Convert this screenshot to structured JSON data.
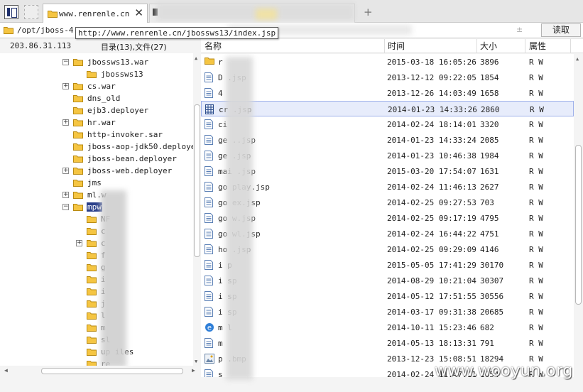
{
  "tab": {
    "title": "www.renrenle.cn"
  },
  "address": {
    "path": "/opt/jboss-4.",
    "sort_icon": "±",
    "read_button": "读取",
    "tooltip": "http://www.renrenle.cn/jbossws13/index.jsp"
  },
  "left": {
    "ip": "203.86.31.113",
    "counts": "目录(13),文件(27)"
  },
  "tree": [
    {
      "label": "jbossws13.war",
      "depth": 0,
      "expander": "−"
    },
    {
      "label": "jbossws13",
      "depth": 1,
      "expander": ""
    },
    {
      "label": "cs.war",
      "depth": 0,
      "expander": "+"
    },
    {
      "label": "dns_old",
      "depth": 0,
      "expander": ""
    },
    {
      "label": "ejb3.deployer",
      "depth": 0,
      "expander": ""
    },
    {
      "label": "hr.war",
      "depth": 0,
      "expander": "+"
    },
    {
      "label": "http-invoker.sar",
      "depth": 0,
      "expander": ""
    },
    {
      "label": "jboss-aop-jdk50.deployer",
      "depth": 0,
      "expander": ""
    },
    {
      "label": "jboss-bean.deployer",
      "depth": 0,
      "expander": ""
    },
    {
      "label": "jboss-web.deployer",
      "depth": 0,
      "expander": "+"
    },
    {
      "label": "jms",
      "depth": 0,
      "expander": ""
    },
    {
      "label": "ml.w",
      "depth": 0,
      "expander": "+"
    },
    {
      "label": "mpw",
      "depth": 0,
      "expander": "−",
      "selected": true
    },
    {
      "label": "NF",
      "depth": 1,
      "expander": ""
    },
    {
      "label": "c",
      "depth": 1,
      "expander": ""
    },
    {
      "label": "c",
      "depth": 1,
      "expander": "+"
    },
    {
      "label": "f",
      "depth": 1,
      "expander": ""
    },
    {
      "label": "g",
      "depth": 1,
      "expander": ""
    },
    {
      "label": "i",
      "depth": 1,
      "expander": ""
    },
    {
      "label": "i",
      "depth": 1,
      "expander": ""
    },
    {
      "label": "j",
      "depth": 1,
      "expander": ""
    },
    {
      "label": "l",
      "depth": 1,
      "expander": ""
    },
    {
      "label": "m",
      "depth": 1,
      "expander": ""
    },
    {
      "label": "sl",
      "depth": 1,
      "expander": ""
    },
    {
      "label": "up  iles",
      "depth": 1,
      "expander": ""
    },
    {
      "label": "re",
      "depth": 1,
      "expander": ""
    }
  ],
  "columns": {
    "name": "名称",
    "time": "时间",
    "size": "大小",
    "attr": "属性"
  },
  "files": [
    {
      "icon": "folder",
      "name": "r",
      "time": "2015-03-18 16:05:26",
      "size": "3896",
      "attr": "R W"
    },
    {
      "icon": "doc",
      "name": "D       .jsp",
      "time": "2013-12-12 09:22:05",
      "size": "1854",
      "attr": "R W"
    },
    {
      "icon": "doc",
      "name": "4",
      "time": "2013-12-26 14:03:49",
      "size": "1658",
      "attr": "R W"
    },
    {
      "icon": "doc-grid",
      "name": "cr        .jsp",
      "time": "2014-01-23 14:33:26",
      "size": "2860",
      "attr": "R W",
      "selected": true
    },
    {
      "icon": "doc",
      "name": "ci",
      "time": "2014-02-24 18:14:01",
      "size": "3320",
      "attr": "R W"
    },
    {
      "icon": "doc",
      "name": "ge     ..jsp",
      "time": "2014-01-23 14:33:24",
      "size": "2085",
      "attr": "R W"
    },
    {
      "icon": "doc",
      "name": "ge     .jsp",
      "time": "2014-01-23 10:46:38",
      "size": "1984",
      "attr": "R W"
    },
    {
      "icon": "doc",
      "name": "mai     .jsp",
      "time": "2015-03-20 17:54:07",
      "size": "1631",
      "attr": "R W"
    },
    {
      "icon": "doc",
      "name": "go      play.jsp",
      "time": "2014-02-24 11:46:13",
      "size": "2627",
      "attr": "R W"
    },
    {
      "icon": "doc",
      "name": "go      ex.jsp",
      "time": "2014-02-25 09:27:53",
      "size": "703",
      "attr": "R W"
    },
    {
      "icon": "doc",
      "name": "go      w.jsp",
      "time": "2014-02-25 09:17:19",
      "size": "4795",
      "attr": "R W"
    },
    {
      "icon": "doc",
      "name": "go      wl.jsp",
      "time": "2014-02-24 16:44:22",
      "size": "4751",
      "attr": "R W"
    },
    {
      "icon": "doc",
      "name": "ho      .jsp",
      "time": "2014-02-25 09:29:09",
      "size": "4146",
      "attr": "R W"
    },
    {
      "icon": "doc",
      "name": "i      p",
      "time": "2015-05-05 17:41:29",
      "size": "30170",
      "attr": "R W"
    },
    {
      "icon": "doc",
      "name": "i      sp",
      "time": "2014-08-29 10:21:04",
      "size": "30307",
      "attr": "R W"
    },
    {
      "icon": "doc",
      "name": "i      sp",
      "time": "2014-05-12 17:51:55",
      "size": "30556",
      "attr": "R W"
    },
    {
      "icon": "doc",
      "name": "i      sp",
      "time": "2014-03-17 09:31:38",
      "size": "20685",
      "attr": "R W"
    },
    {
      "icon": "ie",
      "name": "m      l",
      "time": "2014-10-11 15:23:46",
      "size": "682",
      "attr": "R W"
    },
    {
      "icon": "doc",
      "name": "m",
      "time": "2014-05-13 18:13:31",
      "size": "791",
      "attr": "R W"
    },
    {
      "icon": "image",
      "name": "p      .bmp",
      "time": "2013-12-23 15:08:51",
      "size": "18294",
      "attr": "R W"
    },
    {
      "icon": "doc",
      "name": "s",
      "time": "2014-02-24 11:47:11",
      "size": "1654",
      "attr": "R W"
    }
  ],
  "watermark": "www.wooyun.org",
  "colors": {
    "selection": "#2a3f8a",
    "folder": "#f5c542",
    "row_highlight": "#e7ecfb"
  },
  "icons": {
    "folder": "folder-icon",
    "doc": "document-icon",
    "ie": "internet-explorer-icon",
    "image": "bitmap-icon"
  }
}
